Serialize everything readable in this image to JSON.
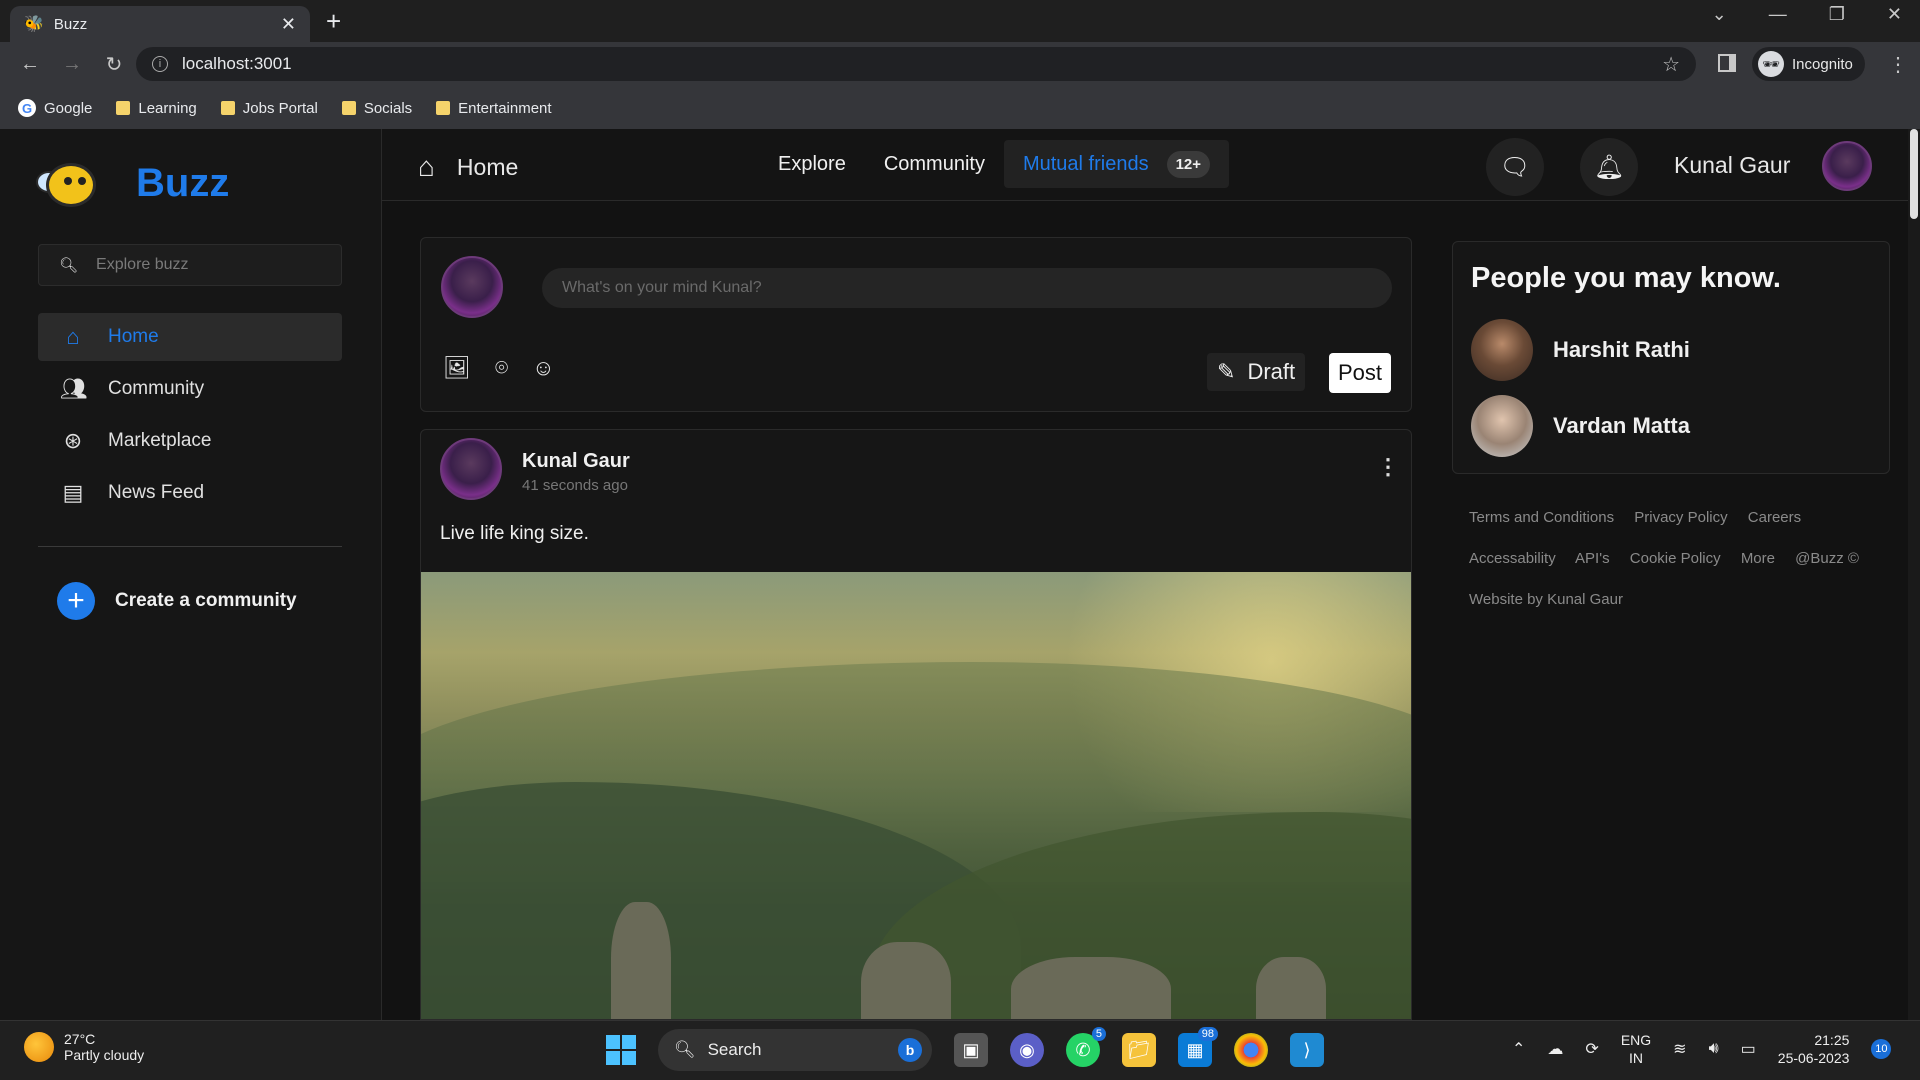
{
  "browser": {
    "tab_title": "Buzz",
    "url": "localhost:3001",
    "profile_label": "Incognito",
    "bookmarks": [
      "Google",
      "Learning",
      "Jobs Portal",
      "Socials",
      "Entertainment"
    ]
  },
  "sidebar": {
    "brand": "Buzz",
    "search_placeholder": "Explore buzz",
    "items": [
      {
        "label": "Home",
        "icon": "home-icon",
        "active": true
      },
      {
        "label": "Community",
        "icon": "users-icon",
        "active": false
      },
      {
        "label": "Marketplace",
        "icon": "rupee-icon",
        "active": false
      },
      {
        "label": "News Feed",
        "icon": "newspaper-icon",
        "active": false
      }
    ],
    "create_label": "Create a community"
  },
  "topbar": {
    "home_label": "Home",
    "nav": {
      "explore": "Explore",
      "community": "Community",
      "mutual_friends": "Mutual friends",
      "mutual_badge": "12+"
    },
    "user_name": "Kunal Gaur"
  },
  "composer": {
    "placeholder": "What's on your mind Kunal?",
    "draft_label": "Draft",
    "post_label": "Post"
  },
  "post": {
    "author": "Kunal Gaur",
    "time": "41 seconds ago",
    "text": "Live life king size."
  },
  "people": {
    "title": "People you may know.",
    "list": [
      "Harshit Rathi",
      "Vardan Matta"
    ]
  },
  "footer": {
    "links_row1": [
      "Terms and Conditions",
      "Privacy Policy",
      "Careers"
    ],
    "links_row2": [
      "Accessability",
      "API's",
      "Cookie Policy",
      "More",
      "@Buzz ©"
    ],
    "credit": "Website by Kunal Gaur"
  },
  "taskbar": {
    "temperature": "27°C",
    "weather": "Partly cloudy",
    "search_label": "Search",
    "whatsapp_badge": "5",
    "store_badge": "98",
    "lang_1": "ENG",
    "lang_2": "IN",
    "time": "21:25",
    "date": "25-06-2023",
    "notifications": "10"
  },
  "colors": {
    "accent": "#1f7bea",
    "background": "#121212",
    "panel": "#161616"
  }
}
